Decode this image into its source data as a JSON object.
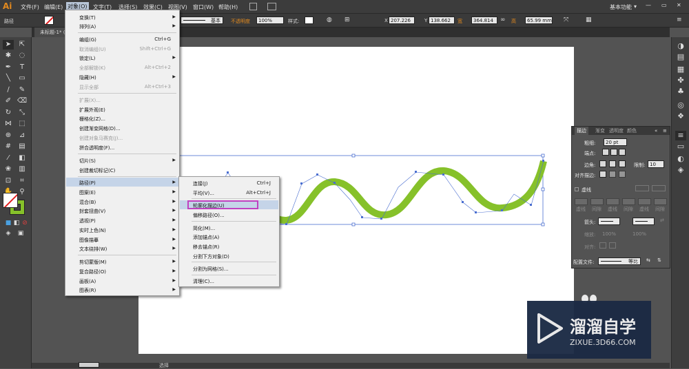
{
  "menubar": {
    "logo": "Ai",
    "items": [
      "文件(F)",
      "编辑(E)",
      "对象(O)",
      "文字(T)",
      "选择(S)",
      "效果(C)",
      "视图(V)",
      "窗口(W)",
      "帮助(H)"
    ],
    "workspace": "基本功能",
    "workspace_arrow": "▾"
  },
  "window_controls": {
    "minimize": "—",
    "restore": "▭",
    "close": "✕"
  },
  "control": {
    "object_type": "路径",
    "stroke_profile": "基本",
    "opacity_label": "不透明度",
    "opacity_value": "100%",
    "style_label": "样式:",
    "x_label": "X",
    "x_value": "207.226",
    "y_label": "Y",
    "y_value": "138.662",
    "w_label": "宽",
    "w_value": "364.814",
    "h_label": "高",
    "h_value": "65.99 mm"
  },
  "document": {
    "tab": "未标题-1* @ 100% (RGB/预览)"
  },
  "object_menu": {
    "items": [
      {
        "label": "变换(T)",
        "shortcut": "",
        "arrow": "▶",
        "disabled": false
      },
      {
        "label": "排列(A)",
        "shortcut": "",
        "arrow": "▶",
        "disabled": false
      },
      {
        "label": "编组(G)",
        "shortcut": "Ctrl+G",
        "arrow": "",
        "disabled": false
      },
      {
        "label": "取消编组(U)",
        "shortcut": "Shift+Ctrl+G",
        "arrow": "",
        "disabled": true
      },
      {
        "label": "锁定(L)",
        "shortcut": "",
        "arrow": "▶",
        "disabled": false
      },
      {
        "label": "全部解锁(K)",
        "shortcut": "Alt+Ctrl+2",
        "arrow": "",
        "disabled": true
      },
      {
        "label": "隐藏(H)",
        "shortcut": "",
        "arrow": "▶",
        "disabled": false
      },
      {
        "label": "显示全部",
        "shortcut": "Alt+Ctrl+3",
        "arrow": "",
        "disabled": true
      },
      {
        "label": "扩展(X)...",
        "shortcut": "",
        "arrow": "",
        "disabled": true
      },
      {
        "label": "扩展外观(E)",
        "shortcut": "",
        "arrow": "",
        "disabled": false
      },
      {
        "label": "栅格化(Z)...",
        "shortcut": "",
        "arrow": "",
        "disabled": false
      },
      {
        "label": "创建渐变网格(D)...",
        "shortcut": "",
        "arrow": "",
        "disabled": false
      },
      {
        "label": "创建对象马赛克(J)...",
        "shortcut": "",
        "arrow": "",
        "disabled": true
      },
      {
        "label": "拼合透明度(F)...",
        "shortcut": "",
        "arrow": "",
        "disabled": false
      },
      {
        "label": "切片(S)",
        "shortcut": "",
        "arrow": "▶",
        "disabled": false
      },
      {
        "label": "创建裁切标记(C)",
        "shortcut": "",
        "arrow": "",
        "disabled": false
      },
      {
        "label": "路径(P)",
        "shortcut": "",
        "arrow": "▶",
        "disabled": false
      },
      {
        "label": "图案(E)",
        "shortcut": "",
        "arrow": "▶",
        "disabled": false
      },
      {
        "label": "混合(B)",
        "shortcut": "",
        "arrow": "▶",
        "disabled": false
      },
      {
        "label": "封套扭曲(V)",
        "shortcut": "",
        "arrow": "▶",
        "disabled": false
      },
      {
        "label": "透视(P)",
        "shortcut": "",
        "arrow": "▶",
        "disabled": false
      },
      {
        "label": "实时上色(N)",
        "shortcut": "",
        "arrow": "▶",
        "disabled": false
      },
      {
        "label": "图像描摹",
        "shortcut": "",
        "arrow": "▶",
        "disabled": false
      },
      {
        "label": "文本绕排(W)",
        "shortcut": "",
        "arrow": "▶",
        "disabled": false
      },
      {
        "label": "剪切蒙版(M)",
        "shortcut": "",
        "arrow": "▶",
        "disabled": false
      },
      {
        "label": "复合路径(O)",
        "shortcut": "",
        "arrow": "▶",
        "disabled": false
      },
      {
        "label": "画板(A)",
        "shortcut": "",
        "arrow": "▶",
        "disabled": false
      },
      {
        "label": "图表(R)",
        "shortcut": "",
        "arrow": "▶",
        "disabled": false
      }
    ]
  },
  "path_submenu": {
    "items": [
      {
        "label": "连接(J)",
        "shortcut": "Ctrl+J"
      },
      {
        "label": "平均(V)...",
        "shortcut": "Alt+Ctrl+J"
      },
      {
        "label": "轮廓化描边(U)",
        "shortcut": ""
      },
      {
        "label": "偏移路径(O)...",
        "shortcut": ""
      },
      {
        "label": "简化(M)...",
        "shortcut": ""
      },
      {
        "label": "添加锚点(A)",
        "shortcut": ""
      },
      {
        "label": "移去锚点(R)",
        "shortcut": ""
      },
      {
        "label": "分割下方对象(D)",
        "shortcut": ""
      },
      {
        "label": "分割为网格(S)...",
        "shortcut": ""
      },
      {
        "label": "清理(C)...",
        "shortcut": ""
      }
    ]
  },
  "stroke_panel": {
    "tabs": [
      "描边",
      "渐变",
      "透明度",
      "颜色"
    ],
    "weight_label": "粗细:",
    "weight_value": "20 pt",
    "cap_label": "端点:",
    "corner_label": "边角:",
    "limit_label": "限制:",
    "limit_value": "10",
    "align_label": "对齐描边:",
    "dashed_label": "虚线",
    "dash_labels": [
      "虚线",
      "间隙",
      "虚线",
      "间隙",
      "虚线",
      "间隙"
    ],
    "arrow_label": "箭头:",
    "scale_label": "缩放:",
    "scale1": "100%",
    "scale2": "100%",
    "align2_label": "对齐:",
    "profile_label": "配置文件:",
    "profile_value": "等比"
  },
  "watermark": {
    "brand": "溜溜自学",
    "url": "ZIXUE.3D66.COM"
  },
  "status": {
    "mode": "选择"
  },
  "colors": {
    "accent": "#e38a1e",
    "stroke_green": "#86c12a",
    "highlight": "#c040c0",
    "selection": "#4a6ed0"
  }
}
